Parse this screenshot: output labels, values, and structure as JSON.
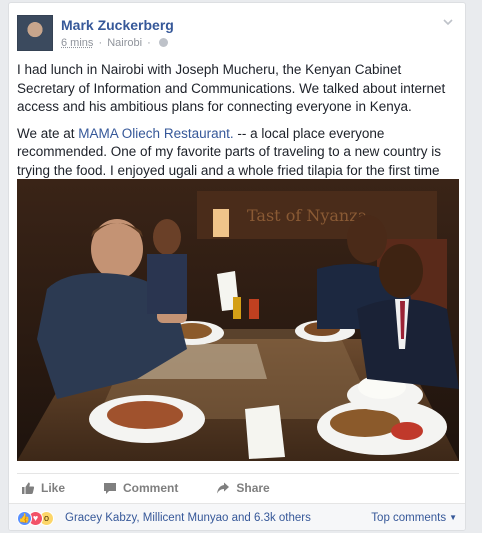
{
  "post": {
    "author": "Mark Zuckerberg",
    "time": "6 mins",
    "location": "Nairobi",
    "separator": "·",
    "paragraph1": "I had lunch in Nairobi with Joseph Mucheru, the Kenyan Cabinet Secretary of Information and Communications. We talked about internet access and his ambitious plans for connecting everyone in Kenya.",
    "paragraph2_prefix": "We ate at ",
    "place_link": "MAMA Oliech Restaurant.",
    "paragraph2_suffix": " -- a local place everyone recommended. One of my favorite parts of traveling to a new country is trying the food. I enjoyed ugali and a whole fried tilapia for the first time and loved them both!",
    "photo_sign_text": "Tast of Nyanza"
  },
  "actions": {
    "like": "Like",
    "comment": "Comment",
    "share": "Share"
  },
  "reactions": {
    "likers": "Gracey Kabzy, Millicent Munyao and 6.3k others",
    "top_comments": "Top comments",
    "icons": [
      "like-icon",
      "love-icon",
      "wow-icon"
    ]
  },
  "colors": {
    "link": "#365899",
    "muted": "#90949c",
    "like_blue": "#5890ff",
    "love_red": "#f25268",
    "wow_yellow": "#fcd669"
  }
}
